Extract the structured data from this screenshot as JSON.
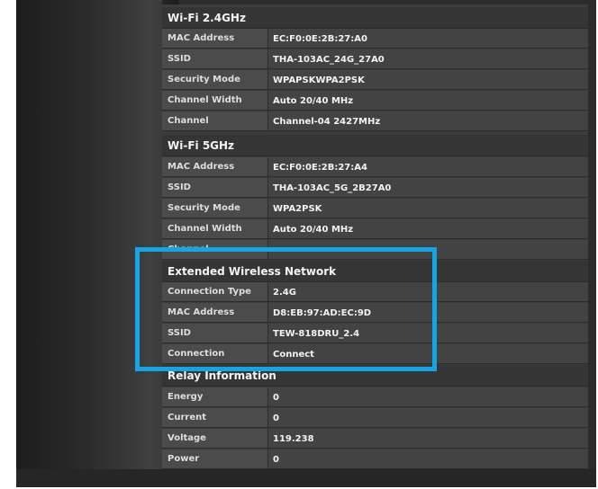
{
  "sections": {
    "wifi24": {
      "title": "Wi-Fi 2.4GHz",
      "rows": [
        {
          "label": "MAC Address",
          "value": "EC:F0:0E:2B:27:A0"
        },
        {
          "label": "SSID",
          "value": "THA-103AC_24G_27A0"
        },
        {
          "label": "Security Mode",
          "value": "WPAPSKWPA2PSK"
        },
        {
          "label": "Channel Width",
          "value": "Auto 20/40 MHz"
        },
        {
          "label": "Channel",
          "value": "Channel-04 2427MHz"
        }
      ]
    },
    "wifi5": {
      "title": "Wi-Fi 5GHz",
      "rows": [
        {
          "label": "MAC Address",
          "value": "EC:F0:0E:2B:27:A4"
        },
        {
          "label": "SSID",
          "value": "THA-103AC_5G_2B27A0"
        },
        {
          "label": "Security Mode",
          "value": "WPA2PSK"
        },
        {
          "label": "Channel Width",
          "value": "Auto 20/40 MHz"
        },
        {
          "label": "Channel",
          "value": ""
        }
      ]
    },
    "extended": {
      "title": "Extended Wireless Network",
      "rows": [
        {
          "label": "Connection Type",
          "value": "2.4G"
        },
        {
          "label": "MAC Address",
          "value": "D8:EB:97:AD:EC:9D"
        },
        {
          "label": "SSID",
          "value": "TEW-818DRU_2.4"
        },
        {
          "label": "Connection",
          "value": "Connect"
        }
      ]
    },
    "relay": {
      "title": "Relay Information",
      "rows": [
        {
          "label": "Energy",
          "value": "0"
        },
        {
          "label": "Current",
          "value": "0"
        },
        {
          "label": "Voltage",
          "value": "119.238"
        },
        {
          "label": "Power",
          "value": "0"
        }
      ]
    }
  },
  "colors": {
    "highlight": "#14a6e4"
  }
}
